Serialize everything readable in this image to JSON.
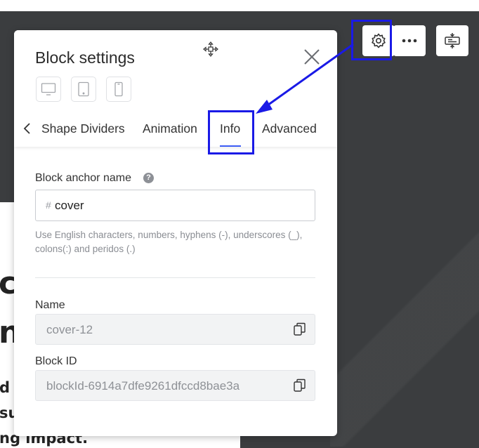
{
  "background": {
    "heading_line1": "c",
    "heading_line2": "n",
    "text_line1": "d s",
    "text_line2": "su",
    "text_line3": "ng impact."
  },
  "toolbar": {
    "settings_icon": "gear-icon",
    "more_icon": "more-dots-icon",
    "layout_icon": "block-layout-icon"
  },
  "panel": {
    "title": "Block settings",
    "devices": [
      "desktop-icon",
      "tablet-icon",
      "mobile-icon"
    ],
    "tabs": [
      {
        "label": "Shape Dividers",
        "active": false
      },
      {
        "label": "Animation",
        "active": false
      },
      {
        "label": "Info",
        "active": true
      },
      {
        "label": "Advanced",
        "active": false
      }
    ],
    "anchor": {
      "label": "Block anchor name",
      "prefix": "#",
      "value": "cover",
      "hint": "Use English characters, numbers, hyphens (-), underscores (_), colons(:) and peridos (.)"
    },
    "name": {
      "label": "Name",
      "value": "cover-12"
    },
    "block_id": {
      "label": "Block ID",
      "value": "blockId-6914a7dfe9261dfccd8bae3a"
    }
  },
  "colors": {
    "accent": "#3d5cf5",
    "highlight": "#1a1ae6",
    "background_dark": "#3b3d3f"
  }
}
